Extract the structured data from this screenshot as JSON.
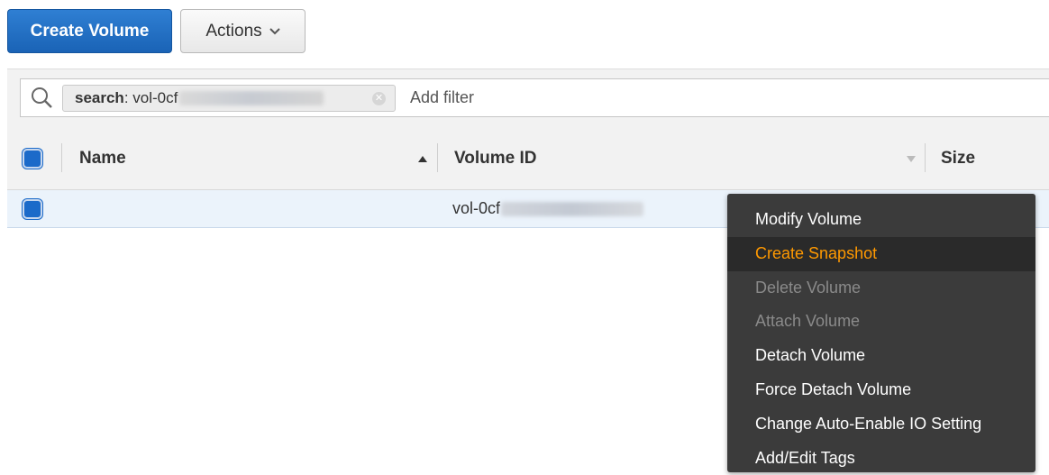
{
  "toolbar": {
    "create_label": "Create Volume",
    "actions_label": "Actions"
  },
  "filter": {
    "token_key": "search",
    "token_value": " : vol-0cf",
    "add_filter_label": "Add filter"
  },
  "table": {
    "columns": [
      "Name",
      "Volume ID",
      "Size"
    ],
    "rows": [
      {
        "name": "",
        "volume_id": "vol-0cf"
      }
    ]
  },
  "context_menu": {
    "items": [
      {
        "label": "Modify Volume",
        "state": "enabled"
      },
      {
        "label": "Create Snapshot",
        "state": "hover"
      },
      {
        "label": "Delete Volume",
        "state": "disabled"
      },
      {
        "label": "Attach Volume",
        "state": "disabled"
      },
      {
        "label": "Detach Volume",
        "state": "enabled"
      },
      {
        "label": "Force Detach Volume",
        "state": "enabled"
      },
      {
        "label": "Change Auto-Enable IO Setting",
        "state": "enabled"
      },
      {
        "label": "Add/Edit Tags",
        "state": "enabled"
      }
    ]
  },
  "colors": {
    "primary": "#1a63b6",
    "menu_bg": "#3b3b3b",
    "menu_highlight": "#ff9900",
    "selected_row": "#ebf3fb"
  },
  "icons": [
    "search-icon",
    "chevron-down-icon",
    "clear-token-icon",
    "sort-ascending-icon",
    "sort-descending-icon"
  ]
}
